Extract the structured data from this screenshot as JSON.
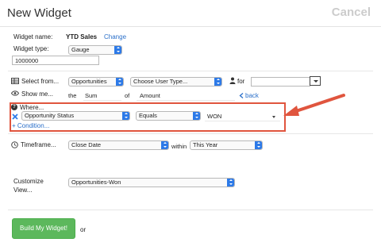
{
  "header": {
    "title": "New Widget",
    "cancel_label": "Cancel"
  },
  "widget_name": {
    "label": "Widget name:",
    "value": "YTD Sales",
    "change_label": "Change"
  },
  "widget_type": {
    "label": "Widget type:",
    "selected": "Gauge",
    "number_value": "1000000"
  },
  "select_from": {
    "label": "Select from...",
    "object": "Opportunities",
    "user_type": "Choose User Type...",
    "for_label": "for",
    "for_value": ""
  },
  "show_me": {
    "label": "Show me...",
    "the_label": "the",
    "aggregate": "Sum",
    "of_label": "of",
    "field": "Amount",
    "back_label": "back"
  },
  "where": {
    "label": "Where...",
    "field": "Opportunity Status",
    "operator": "Equals",
    "value": "WON",
    "add_condition_label": "+ Condition..."
  },
  "timeframe": {
    "label": "Timeframe...",
    "date_field": "Close Date",
    "within_label": "within",
    "period": "This Year"
  },
  "customize_view": {
    "label_line1": "Customize",
    "label_line2": "View...",
    "selected": "Opportunities-Won"
  },
  "footer": {
    "build_label": "Build My Widget!",
    "or_label": "or"
  },
  "colors": {
    "link": "#2a6fc9",
    "select_arrow": "#2d7ae8",
    "highlight_border": "#e0553e",
    "build_button": "#5cb85c"
  },
  "icons": [
    "table-icon",
    "eye-icon",
    "question-icon",
    "close-icon",
    "clock-icon",
    "user-icon",
    "chevron-left-icon",
    "caret-down-icon"
  ]
}
